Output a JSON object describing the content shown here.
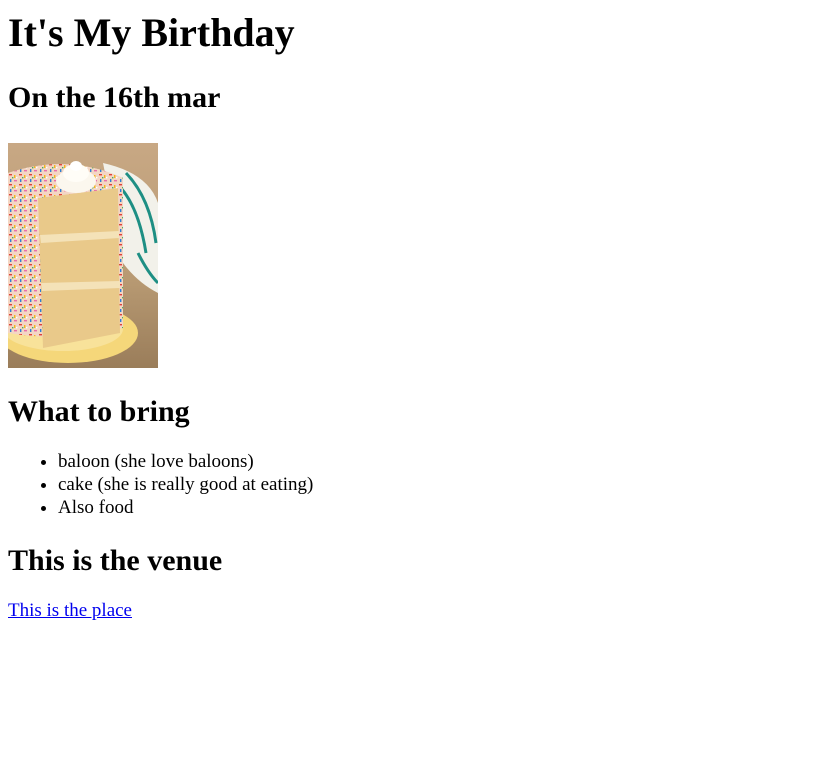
{
  "page": {
    "title": "It's My Birthday",
    "subtitle": "On the 16th mar"
  },
  "image": {
    "alt": "cake-icon",
    "colors": {
      "background": "#b89a73",
      "cake": "#e9c98a",
      "frosting": "#f2dcb0",
      "plate": "#f5d77a",
      "towel_stripe": "#1e8f84"
    }
  },
  "bring": {
    "heading": "What to bring",
    "items": [
      "baloon (she love baloons)",
      "cake (she is really good at eating)",
      "Also food"
    ]
  },
  "venue": {
    "heading": "This is the venue",
    "link_text": "This is the place"
  }
}
